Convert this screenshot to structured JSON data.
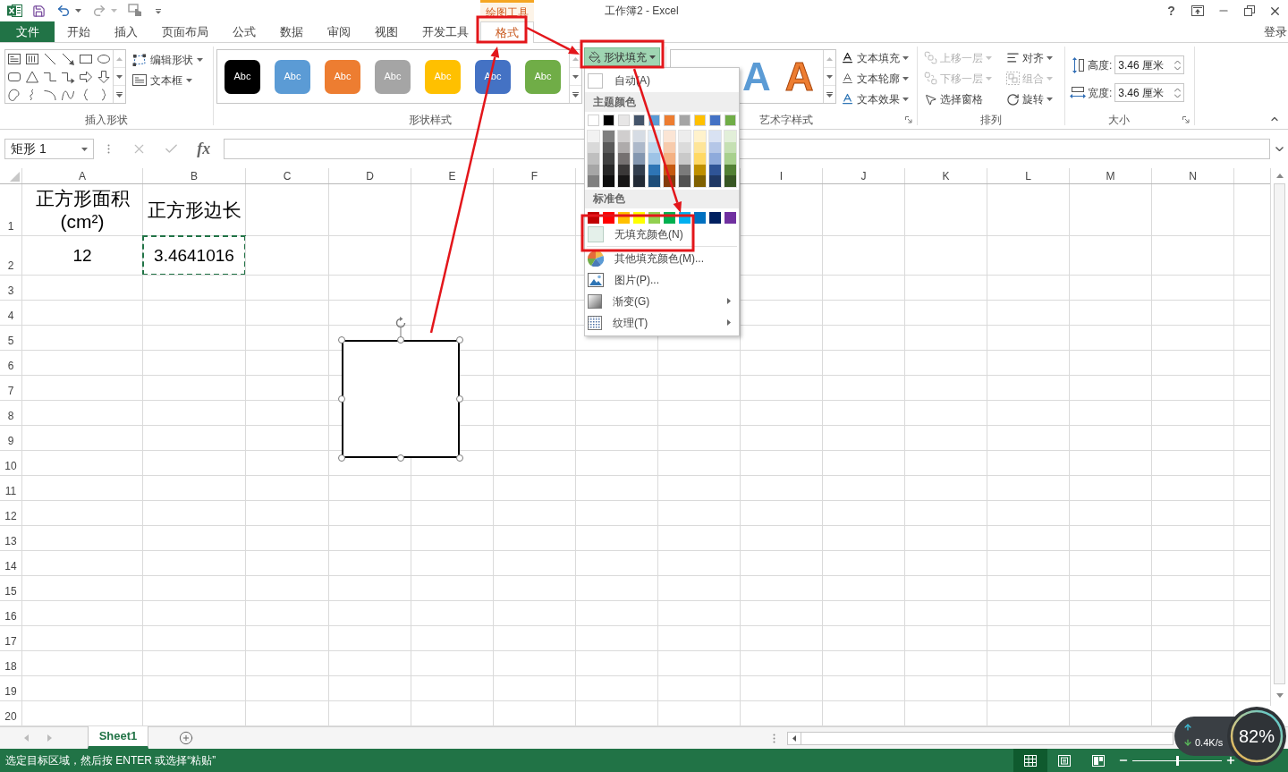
{
  "title_bar": {
    "title": "工作簿2 - Excel",
    "context_group": "绘图工具",
    "help": "?"
  },
  "quick_access": [
    {
      "kind": "save",
      "disabled": false
    },
    {
      "kind": "undo",
      "disabled": false
    },
    {
      "kind": "redo",
      "disabled": true
    },
    {
      "kind": "touch_mode",
      "disabled": false
    }
  ],
  "ribbon_tabs": [
    {
      "label": "文件",
      "kind": "file",
      "selected": false
    },
    {
      "label": "开始",
      "kind": "tab",
      "selected": false
    },
    {
      "label": "插入",
      "kind": "tab",
      "selected": false
    },
    {
      "label": "页面布局",
      "kind": "tab",
      "selected": false
    },
    {
      "label": "公式",
      "kind": "tab",
      "selected": false
    },
    {
      "label": "数据",
      "kind": "tab",
      "selected": false
    },
    {
      "label": "审阅",
      "kind": "tab",
      "selected": false
    },
    {
      "label": "视图",
      "kind": "tab",
      "selected": false
    },
    {
      "label": "开发工具",
      "kind": "tab",
      "selected": false
    },
    {
      "label": "格式",
      "kind": "contextual",
      "selected": true
    }
  ],
  "sign_in": "登录",
  "ribbon": {
    "insert_shapes": {
      "label": "插入形状",
      "buttons": [
        {
          "label": "编辑形状",
          "kind": "edit_shape"
        },
        {
          "label": "文本框",
          "kind": "text_box"
        }
      ]
    },
    "shape_styles": {
      "label": "形状样式",
      "swatches": [
        {
          "text": "Abc",
          "color": "#000000"
        },
        {
          "text": "Abc",
          "color": "#5b9bd5"
        },
        {
          "text": "Abc",
          "color": "#ed7d31"
        },
        {
          "text": "Abc",
          "color": "#a5a5a5"
        },
        {
          "text": "Abc",
          "color": "#ffc000"
        },
        {
          "text": "Abc",
          "color": "#4472c4"
        },
        {
          "text": "Abc",
          "color": "#70ad47"
        }
      ],
      "fill_button": {
        "label": "形状填充",
        "expanded": true
      }
    },
    "wordart_styles": {
      "label": "艺术字样式",
      "samples": [
        {
          "text": "A",
          "kind": "filled",
          "color": "#5b9bd5"
        },
        {
          "text": "A",
          "kind": "outlined",
          "color": "#ed7d31"
        }
      ],
      "buttons": [
        {
          "label": "文本填充",
          "kind": "text_fill"
        },
        {
          "label": "文本轮廓",
          "kind": "text_outline"
        },
        {
          "label": "文本效果",
          "kind": "text_effects"
        }
      ]
    },
    "arrange": {
      "label": "排列",
      "buttons": [
        {
          "label": "上移一层",
          "kind": "bring_forward",
          "disabled": true,
          "dropdown": true
        },
        {
          "label": "下移一层",
          "kind": "send_backward",
          "disabled": true,
          "dropdown": true
        },
        {
          "label": "选择窗格",
          "kind": "selection_pane",
          "disabled": false,
          "dropdown": false
        },
        {
          "label": "对齐",
          "kind": "align",
          "disabled": false,
          "dropdown": true
        },
        {
          "label": "组合",
          "kind": "group",
          "disabled": true,
          "dropdown": true
        },
        {
          "label": "旋转",
          "kind": "rotate",
          "disabled": false,
          "dropdown": true
        }
      ]
    },
    "size": {
      "label": "大小",
      "fields": [
        {
          "label": "高度:",
          "value": "3.46 厘米",
          "kind": "height"
        },
        {
          "label": "宽度:",
          "value": "3.46 厘米",
          "kind": "width"
        }
      ]
    }
  },
  "fill_menu": {
    "auto": "自动(A)",
    "theme_header": "主题颜色",
    "theme_colors": [
      {
        "color": "#ffffff",
        "shades": [
          {
            "color": "#f2f2f2"
          },
          {
            "color": "#d9d9d9"
          },
          {
            "color": "#bfbfbf"
          },
          {
            "color": "#a6a6a6"
          },
          {
            "color": "#808080"
          }
        ]
      },
      {
        "color": "#000000",
        "shades": [
          {
            "color": "#7f7f7f"
          },
          {
            "color": "#595959"
          },
          {
            "color": "#404040"
          },
          {
            "color": "#262626"
          },
          {
            "color": "#0d0d0d"
          }
        ]
      },
      {
        "color": "#e7e6e6",
        "shades": [
          {
            "color": "#d0cece"
          },
          {
            "color": "#aeabab"
          },
          {
            "color": "#757171"
          },
          {
            "color": "#3a3838"
          },
          {
            "color": "#171616"
          }
        ]
      },
      {
        "color": "#44546a",
        "shades": [
          {
            "color": "#d6dce4"
          },
          {
            "color": "#adb9ca"
          },
          {
            "color": "#8497b0"
          },
          {
            "color": "#333f4f"
          },
          {
            "color": "#222a35"
          }
        ]
      },
      {
        "color": "#5b9bd5",
        "shades": [
          {
            "color": "#deebf6"
          },
          {
            "color": "#bdd7ee"
          },
          {
            "color": "#9dc3e6"
          },
          {
            "color": "#2e75b5"
          },
          {
            "color": "#1f4e79"
          }
        ]
      },
      {
        "color": "#ed7d31",
        "shades": [
          {
            "color": "#fbe5d5"
          },
          {
            "color": "#f7cbac"
          },
          {
            "color": "#f4b183"
          },
          {
            "color": "#c55a11"
          },
          {
            "color": "#843c0b"
          }
        ]
      },
      {
        "color": "#a5a5a5",
        "shades": [
          {
            "color": "#ededed"
          },
          {
            "color": "#dbdbdb"
          },
          {
            "color": "#c9c9c9"
          },
          {
            "color": "#7b7b7b"
          },
          {
            "color": "#525252"
          }
        ]
      },
      {
        "color": "#ffc000",
        "shades": [
          {
            "color": "#fff2cc"
          },
          {
            "color": "#fee599"
          },
          {
            "color": "#ffd965"
          },
          {
            "color": "#bf9000"
          },
          {
            "color": "#7f6000"
          }
        ]
      },
      {
        "color": "#4472c4",
        "shades": [
          {
            "color": "#d9e2f3"
          },
          {
            "color": "#b4c6e7"
          },
          {
            "color": "#8eaadb"
          },
          {
            "color": "#2f5496"
          },
          {
            "color": "#1f3864"
          }
        ]
      },
      {
        "color": "#70ad47",
        "shades": [
          {
            "color": "#e2efd9"
          },
          {
            "color": "#c5e0b3"
          },
          {
            "color": "#a8d08d"
          },
          {
            "color": "#538135"
          },
          {
            "color": "#375623"
          }
        ]
      }
    ],
    "standard_header": "标准色",
    "standard_colors": [
      {
        "color": "#c00000"
      },
      {
        "color": "#ff0000"
      },
      {
        "color": "#ffc000"
      },
      {
        "color": "#ffff00"
      },
      {
        "color": "#92d050"
      },
      {
        "color": "#00b050"
      },
      {
        "color": "#00b0f0"
      },
      {
        "color": "#0070c0"
      },
      {
        "color": "#002060"
      },
      {
        "color": "#7030a0"
      }
    ],
    "items": [
      {
        "label": "无填充颜色(N)",
        "kind": "no_fill",
        "submenu": false
      },
      {
        "label": "其他填充颜色(M)...",
        "kind": "more_colors",
        "submenu": false
      },
      {
        "label": "图片(P)...",
        "kind": "picture",
        "submenu": false
      },
      {
        "label": "渐变(G)",
        "kind": "gradient",
        "submenu": true
      },
      {
        "label": "纹理(T)",
        "kind": "texture",
        "submenu": true
      }
    ]
  },
  "formula_bar": {
    "name_box": "矩形 1",
    "function_label": "fx"
  },
  "sheet": {
    "columns_left": [
      "A",
      "B",
      "C",
      "D",
      "E",
      "F"
    ],
    "columns_right": [
      "I",
      "J",
      "K",
      "L",
      "M",
      "N"
    ],
    "rows": [
      {
        "header": "1",
        "cells": [
          {
            "text": "正方形面积\n(cm²)",
            "marquee": false
          },
          {
            "text": "正方形边长",
            "marquee": false
          }
        ]
      },
      {
        "header": "2",
        "cells": [
          {
            "text": "12",
            "marquee": false
          },
          {
            "text": "3.4641016",
            "marquee": true
          }
        ]
      },
      {
        "header": "3"
      },
      {
        "header": "4"
      },
      {
        "header": "5"
      },
      {
        "header": "6"
      },
      {
        "header": "7"
      },
      {
        "header": "8"
      },
      {
        "header": "9"
      },
      {
        "header": "10"
      },
      {
        "header": "11"
      },
      {
        "header": "12"
      },
      {
        "header": "13"
      },
      {
        "header": "14"
      },
      {
        "header": "15"
      },
      {
        "header": "16"
      },
      {
        "header": "17"
      },
      {
        "header": "18"
      },
      {
        "header": "19"
      },
      {
        "header": "20"
      }
    ]
  },
  "shape": {
    "selected": true
  },
  "sheet_tabs": [
    {
      "label": "Sheet1",
      "selected": true
    }
  ],
  "status_bar": {
    "message": "选定目标区域，然后按 ENTER 或选择“粘贴”",
    "views": [
      {
        "kind": "normal",
        "selected": true
      },
      {
        "kind": "page_layout",
        "selected": false
      },
      {
        "kind": "page_break",
        "selected": false
      }
    ],
    "zoom": {
      "level": 0.5
    }
  },
  "speed_widget": {
    "download": "0.4K/s",
    "usage": "82%"
  }
}
